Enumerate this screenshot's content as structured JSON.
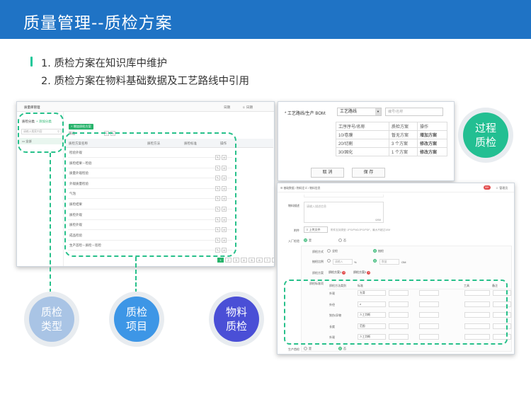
{
  "header": {
    "title": "质量管理--质检方案"
  },
  "points": [
    "1. 质检方案在知识库中维护",
    "2. 质检方案在物料基础数据及工艺路线中引用"
  ],
  "colors": {
    "brand": "#1f73c5",
    "accent": "#27c08a"
  },
  "left_panel": {
    "title": "质量库管理",
    "top_right": "日期",
    "user": "日期",
    "tree_tab": "质检分类",
    "add_category": "+ 添加分类",
    "search_placeholder": "请输入搜索内容",
    "tree_item": "全部",
    "add_scheme": "+ 增加质检方案",
    "filter_label": "筛选",
    "columns": [
      "质检方案名称",
      "质检方法",
      "质检标准",
      "操作"
    ],
    "rows": [
      "检验外观",
      "质检结果－检验",
      "质量外观检验",
      "外观质量检验",
      "气泡",
      "质检结果",
      "质检外观",
      "质检外观",
      "成品检验",
      "生产首检－质检－巡检"
    ],
    "pages": [
      "1",
      "2",
      "3",
      "4",
      "5",
      "6",
      "7",
      "›"
    ]
  },
  "process_panel": {
    "route_label": "* 工艺路线/生产 BOM:",
    "route_select": "工艺路线",
    "code_placeholder": "编号/名称",
    "headers": [
      "工序序号/名称",
      "质检方案",
      "操作"
    ],
    "rows": [
      {
        "step": "10/卷膜",
        "scheme": "暂无方案",
        "op": "增加方案"
      },
      {
        "step": "20/切割",
        "scheme": "3 个方案",
        "op": "修改方案"
      },
      {
        "step": "30/固化",
        "scheme": "1 个方案",
        "op": "修改方案"
      }
    ],
    "cancel": "取 消",
    "save": "保 存"
  },
  "material_panel": {
    "breadcrumb": "基础数据 / 物料定义 / 物料信息",
    "badge": "99+",
    "user": "管理员",
    "desc_label": "物料描述",
    "desc_placeholder": "请输入描述信息",
    "counter": "0/50",
    "attach_label": "附件",
    "upload": "上传文件",
    "upload_hint": "附件支持类型: JPG/PNG/JPG/PDF，最大不超过10M",
    "inspect_label": "入厂检验",
    "yes": "是",
    "no": "否",
    "method_label": "质检方式",
    "method_all": "全检",
    "method_sample": "抽检",
    "ratio_label": "抽检比例",
    "ratio_placeholder": "请输入",
    "percent": "%",
    "qty_placeholder": "数量",
    "unit": "OM",
    "scheme_label": "质检方案",
    "scheme_1": "质检方案1",
    "scheme_2": "质检方案2",
    "standard_label": "质检标准项",
    "grid_headers": [
      "质检方法类别",
      "标准",
      "工具",
      "备注"
    ],
    "grid_rows": [
      {
        "name": "外观",
        "std": "光滑"
      },
      {
        "name": "外径",
        "std": "≥"
      },
      {
        "name": "划伤/异物",
        "std": "人工判断"
      },
      {
        "name": "长度",
        "std": "范围"
      },
      {
        "name": "外观",
        "std": "人工判断"
      }
    ],
    "production_label": "生产首检"
  },
  "labels": {
    "type": [
      "质检",
      "类型"
    ],
    "item": [
      "质检",
      "项目"
    ],
    "material": [
      "物料",
      "质检"
    ],
    "process": [
      "过程",
      "质检"
    ]
  }
}
